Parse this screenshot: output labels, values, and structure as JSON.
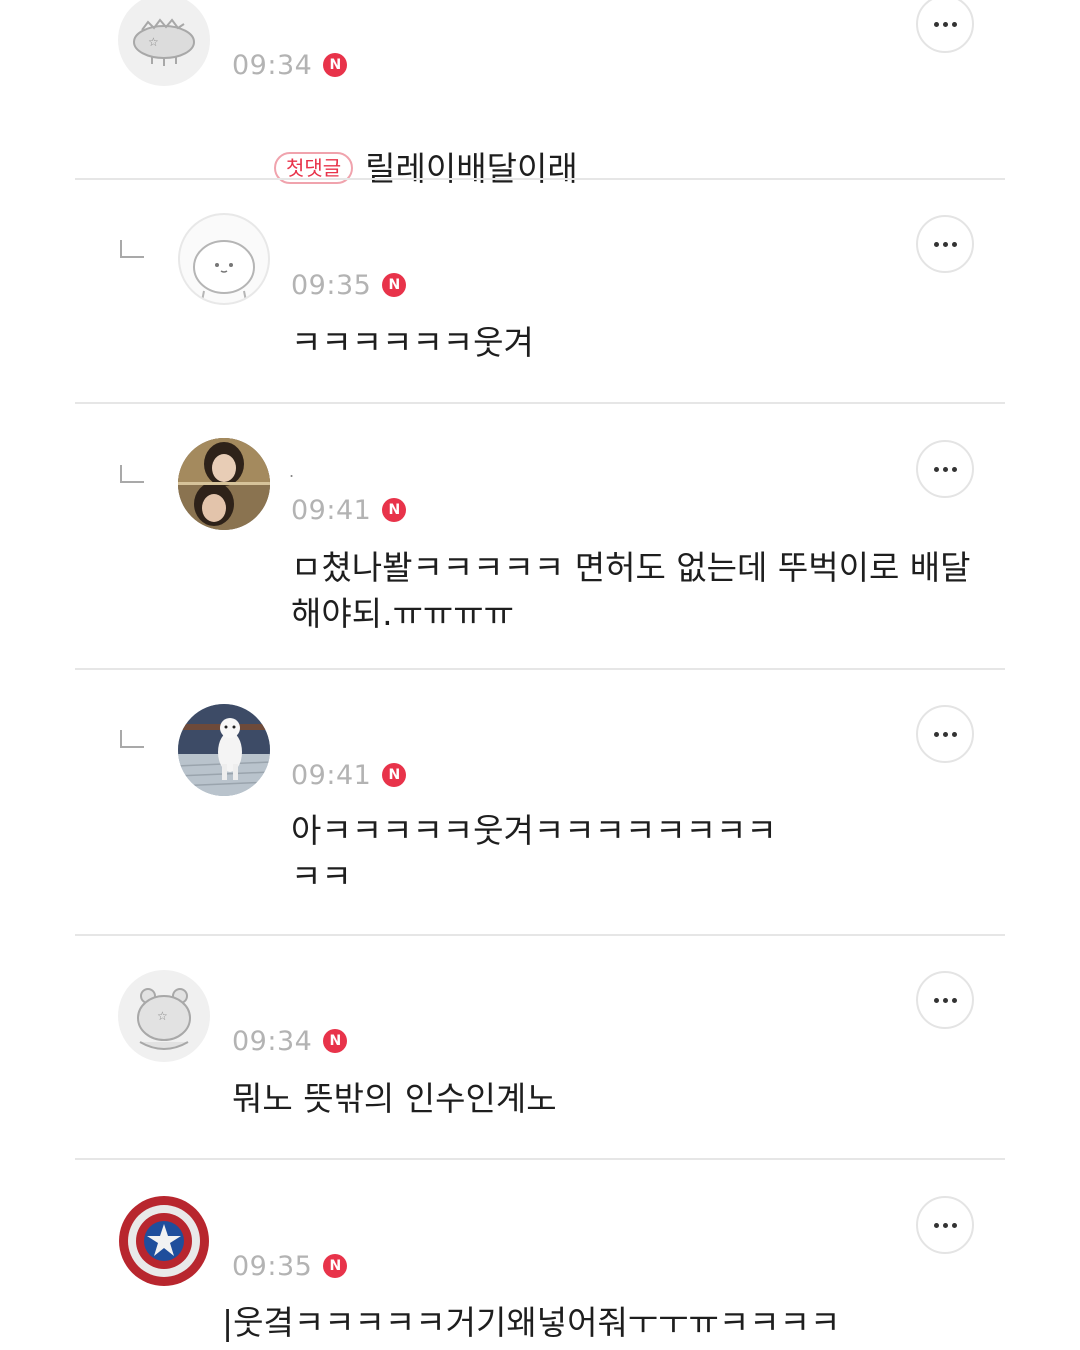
{
  "comments": [
    {
      "time": "09:34",
      "badge": "N",
      "first_badge": "첫댓글",
      "text": "릴레이배달이래",
      "is_reply": false,
      "avatar": "dinosaur-avatar-icon"
    },
    {
      "time": "09:35",
      "badge": "N",
      "text": "ㅋㅋㅋㅋㅋㅋ웃겨",
      "is_reply": true,
      "avatar": "bear-face-avatar-icon"
    },
    {
      "nickname": ".",
      "time": "09:41",
      "badge": "N",
      "text": "ㅁ쳤나봘ㅋㅋㅋㅋㅋ 면허도 없는데 뚜벅이로 배달해야되.ㅠㅠㅠㅠ",
      "is_reply": true,
      "avatar": "girl-photo-avatar"
    },
    {
      "time": "09:41",
      "badge": "N",
      "text": "아ㅋㅋㅋㅋㅋ웃겨ㅋㅋㅋㅋㅋㅋㅋㅋ\nㅋㅋ",
      "is_reply": true,
      "avatar": "dog-photo-avatar"
    },
    {
      "time": "09:34",
      "badge": "N",
      "text": "뭐노 뜻밖의 인수인계노",
      "is_reply": false,
      "avatar": "bear-avatar-icon"
    },
    {
      "time": "09:35",
      "badge": "N",
      "text": "|웃곀ㅋㅋㅋㅋㅋ거기왜넣어줘ㅜㅜㅠㅋㅋㅋㅋ",
      "is_reply": false,
      "avatar": "shield-avatar-icon"
    }
  ],
  "colors": {
    "badge": "#e8334a",
    "time": "#b3b3b3",
    "divider": "#e6e6e6"
  }
}
